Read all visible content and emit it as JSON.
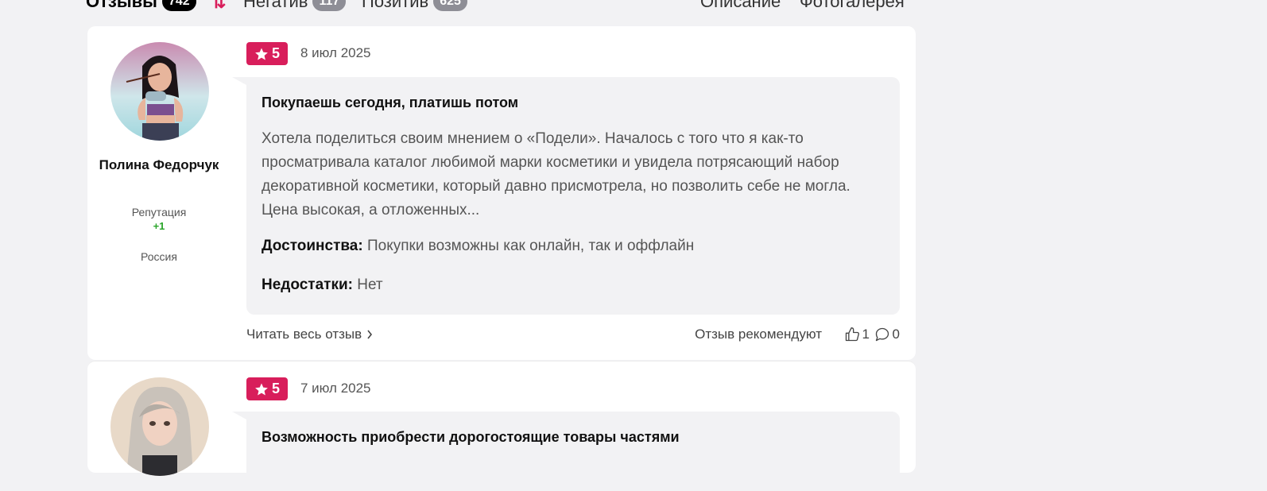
{
  "tabs": {
    "reviews_label": "Отзывы",
    "reviews_count": "742",
    "negative_label": "Негатив",
    "negative_count": "117",
    "positive_label": "Позитив",
    "positive_count": "625",
    "description_label": "Описание",
    "gallery_label": "Фотогалерея"
  },
  "reviews": [
    {
      "author": "Полина Федорчук",
      "reputation_label": "Репутация",
      "reputation_value": "+1",
      "country": "Россия",
      "rating": "5",
      "date": "8 июл 2025",
      "title": "Покупаешь сегодня, платишь потом",
      "text": "Хотела поделиться своим мнением о «Подели». Началось с того что я как-то просматривала каталог любимой марки косметики и увидела потрясающий набор декоративной косметики, который давно присмотрела, но позволить себе не могла. Цена высокая, а отложенных...",
      "pros_label": "Достоинства:",
      "pros": "Покупки возможны как онлайн, так и оффлайн",
      "cons_label": "Недостатки:",
      "cons": "Нет",
      "read_more": "Читать весь отзыв",
      "recommend": "Отзыв рекомендуют",
      "likes": "1",
      "comments": "0"
    },
    {
      "rating": "5",
      "date": "7 июл 2025",
      "title": "Возможность приобрести дорогостоящие товары частями"
    }
  ],
  "colors": {
    "accent": "#d81e5b",
    "reputation": "#2aa52a"
  }
}
